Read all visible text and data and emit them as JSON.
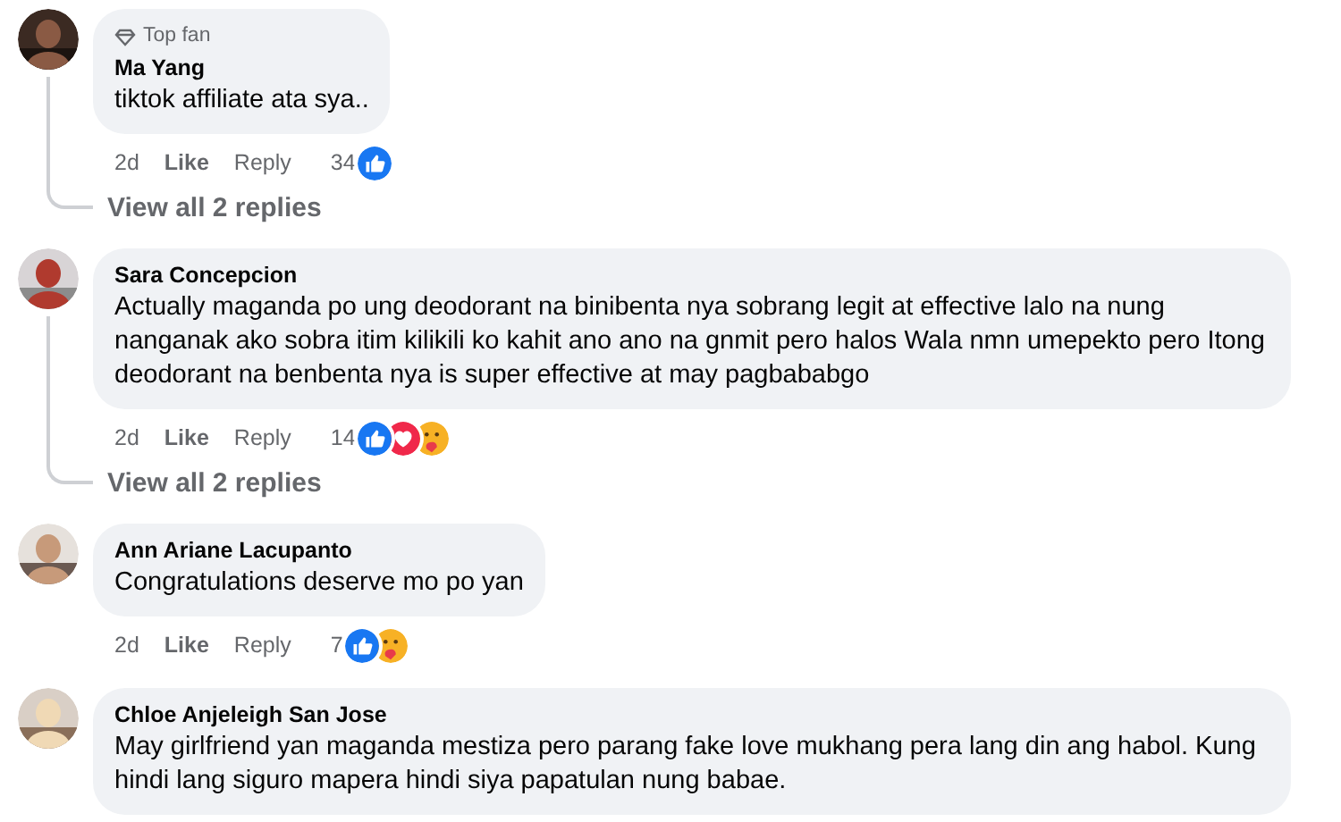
{
  "comments": [
    {
      "author": "Ma Yang",
      "badge": "Top fan",
      "text": "tiktok affiliate ata sya..",
      "time": "2d",
      "actions": [
        "Like",
        "Reply"
      ],
      "count": "34",
      "reactions": [
        {
          "kind": "like"
        }
      ],
      "replies_link": "View all 2 replies"
    },
    {
      "author": "Sara Concepcion",
      "text": "Actually maganda po ung deodorant na binibenta nya sobrang legit at effective lalo na nung nanganak ako sobra itim kilikili ko kahit ano ano na gnmit pero halos Wala nmn umepekto pero Itong deodorant na benbenta nya is super effective at may pagbababgo",
      "time": "2d",
      "actions": [
        "Like",
        "Reply"
      ],
      "count": "14",
      "reactions": [
        {
          "kind": "like"
        },
        {
          "kind": "love"
        },
        {
          "kind": "care"
        }
      ],
      "replies_link": "View all 2 replies"
    },
    {
      "author": "Ann Ariane Lacupanto",
      "text": "Congratulations deserve mo po yan",
      "time": "2d",
      "actions": [
        "Like",
        "Reply"
      ],
      "count": "7",
      "reactions": [
        {
          "kind": "like"
        },
        {
          "kind": "care"
        }
      ]
    },
    {
      "author": "Chloe Anjeleigh San Jose",
      "text": "May girlfriend yan maganda mestiza pero parang fake love mukhang pera lang din ang habol. Kung hindi lang siguro mapera hindi siya papatulan nung babae."
    }
  ]
}
